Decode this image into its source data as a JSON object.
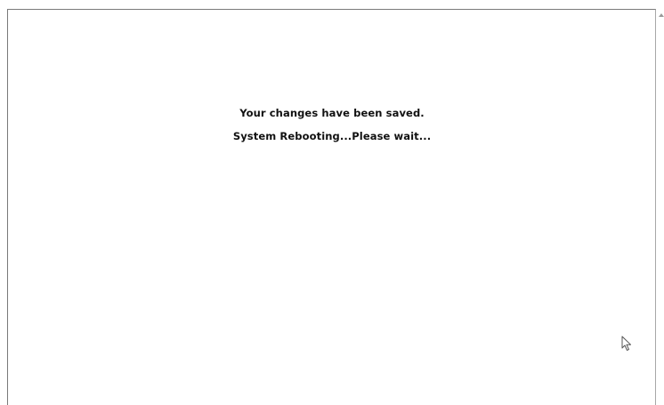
{
  "messages": {
    "saved": "Your changes have been saved.",
    "rebooting": "System Rebooting...Please wait..."
  },
  "colors": {
    "background": "#ffffff",
    "text": "#111111",
    "frame_border": "#7a7a7a"
  },
  "icons": {
    "cursor": "mouse-pointer-icon",
    "scroll_up": "scroll-up-arrow-icon"
  }
}
